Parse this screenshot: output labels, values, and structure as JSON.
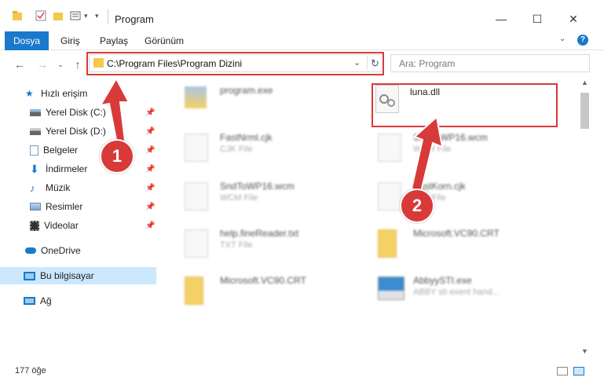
{
  "window": {
    "title": "Program",
    "minimize": "—",
    "maximize": "☐",
    "close": "✕"
  },
  "ribbon": {
    "tabs": [
      "Dosya",
      "Giriş",
      "Paylaş",
      "Görünüm"
    ]
  },
  "address": {
    "path": "C:\\Program Files\\Program Dizini",
    "search_placeholder": "Ara: Program"
  },
  "sidebar": {
    "quick_access": "Hızlı erişim",
    "items": [
      "Yerel Disk (C:)",
      "Yerel Disk (D:)",
      "Belgeler",
      "İndirmeler",
      "Müzik",
      "Resimler",
      "Videolar"
    ],
    "onedrive": "OneDrive",
    "this_pc": "Bu bilgisayar",
    "network": "Ağ"
  },
  "files": [
    {
      "name": "program.exe",
      "desc": ""
    },
    {
      "name": "luna.dll",
      "desc": ""
    },
    {
      "name": "FastNrml.cjk",
      "desc": "CJK File"
    },
    {
      "name": "SndToWP16.wcm",
      "desc": "WCM File"
    },
    {
      "name": "SndToWP16.wcm",
      "desc": "WCM File"
    },
    {
      "name": "FastKorn.cjk",
      "desc": "CJK File"
    },
    {
      "name": "help.fineReader.txt",
      "desc": "TXT File"
    },
    {
      "name": "Microsoft.VC90.CRT",
      "desc": ""
    },
    {
      "name": "Microsoft.VC90.CRT",
      "desc": ""
    },
    {
      "name": "AbbyySTI.exe",
      "desc": "ABBY sti event hand..."
    }
  ],
  "status": {
    "count": "177 öğe"
  },
  "callouts": [
    "1",
    "2"
  ],
  "colors": {
    "accent": "#1979ca",
    "highlight": "#d83a3a",
    "selected": "#cce8ff"
  }
}
